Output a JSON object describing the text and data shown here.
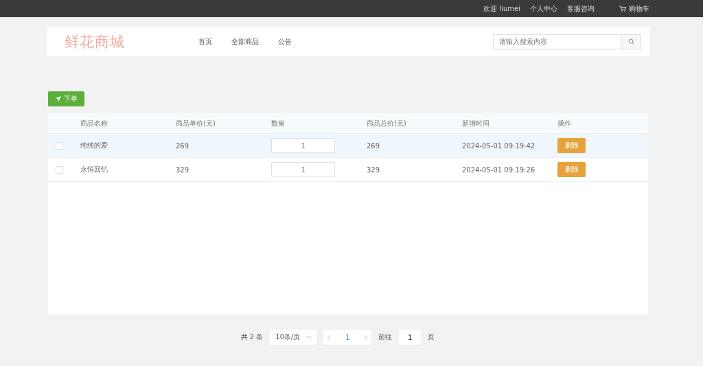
{
  "top_bar": {
    "welcome": "欢迎",
    "username": "liumei",
    "links": [
      "个人中心",
      "客服咨询"
    ],
    "cart": "购物车"
  },
  "header": {
    "logo": "鲜花商城",
    "nav": [
      {
        "label": "首页",
        "selected": false
      },
      {
        "label": "全部商品",
        "selected": false
      },
      {
        "label": "公告",
        "selected": false
      }
    ],
    "search": {
      "placeholder": "请输入搜索内容"
    }
  },
  "order_button": "下单",
  "table": {
    "columns": [
      "商品名称",
      "商品单价(元)",
      "数量",
      "商品总价(元)",
      "新增时间",
      "操作"
    ],
    "rows": [
      {
        "checked": false,
        "hovered": true,
        "name": "纯纯的爱",
        "price": "269",
        "quantity": "1",
        "total": "269",
        "time": "2024-05-01 09:19:42",
        "action": "删除"
      },
      {
        "checked": false,
        "hovered": false,
        "name": "永恒回忆",
        "price": "329",
        "quantity": "1",
        "total": "329",
        "time": "2024-05-01 09:19:26",
        "action": "删除"
      }
    ]
  },
  "pagination": {
    "total": "共 2 条",
    "page_size": "10条/页",
    "pages": [
      {
        "label": "1",
        "selected": true
      }
    ],
    "goto_label": "前往",
    "goto_value": "1",
    "goto_suffix": "页"
  }
}
